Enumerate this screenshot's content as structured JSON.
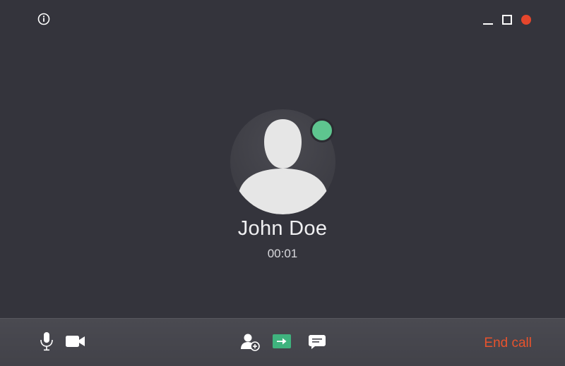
{
  "caller": {
    "name": "John Doe",
    "duration": "00:01",
    "status": "online",
    "status_color": "#5ec58f"
  },
  "header": {
    "info_icon": "info-icon",
    "window_controls": [
      "minimize-icon",
      "maximize-icon",
      "close-icon"
    ],
    "close_color": "#e5462c"
  },
  "toolbar": {
    "left_buttons": [
      "microphone-icon",
      "video-camera-icon"
    ],
    "center_buttons": [
      "add-participant-icon",
      "share-screen-icon",
      "chat-icon"
    ],
    "share_accent": "#3fb37e",
    "end_call_label": "End call",
    "end_call_color": "#e8532d"
  },
  "colors": {
    "background": "#34343c",
    "toolbar": "#46464d"
  }
}
